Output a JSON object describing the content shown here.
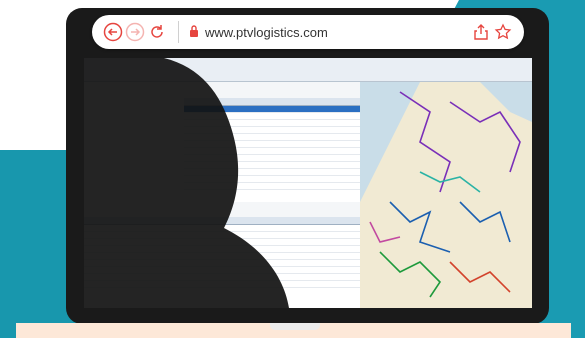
{
  "browser": {
    "url": "www.ptvlogistics.com",
    "icons": [
      "back-icon",
      "forward-icon",
      "reload-icon",
      "lock-icon",
      "share-icon",
      "bookmark-star-icon"
    ]
  },
  "colors": {
    "teal": "#1a9bb2",
    "accent_red": "#e6453f",
    "selection_blue": "#2b6fc2",
    "map_land": "#f1ead3"
  }
}
